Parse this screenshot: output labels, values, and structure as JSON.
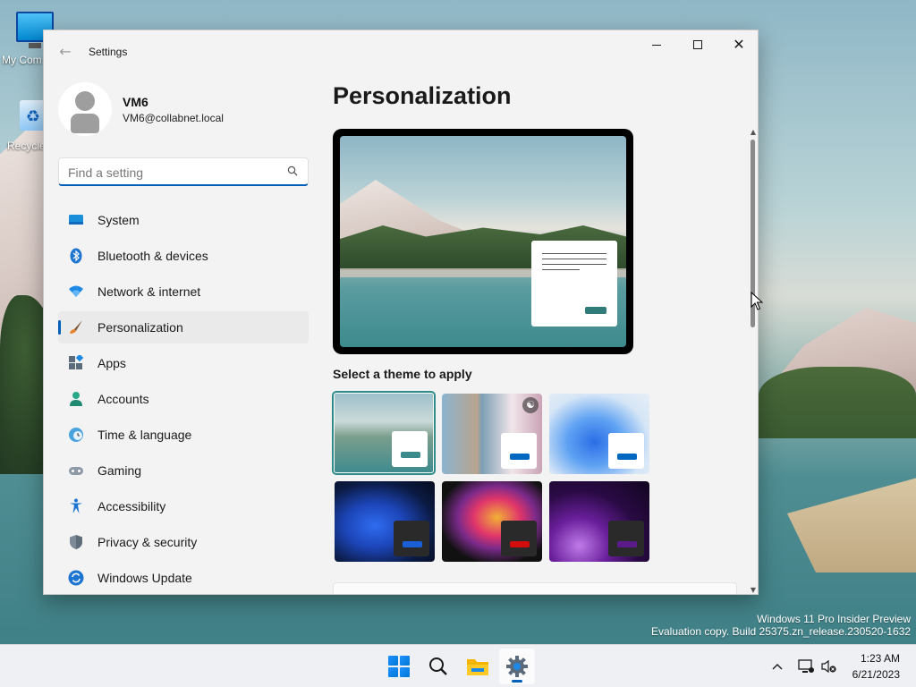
{
  "desktop": {
    "icons": [
      {
        "label": "My Com",
        "kind": "computer-icon"
      },
      {
        "label": "Recycle",
        "kind": "recycle-bin-icon"
      }
    ],
    "watermark": {
      "line1": "Windows 11 Pro Insider Preview",
      "line2": "Evaluation copy. Build 25375.zn_release.230520-1632"
    }
  },
  "window": {
    "title": "Settings",
    "controls": {
      "minimize": "minimize",
      "maximize": "maximize",
      "close": "close"
    }
  },
  "profile": {
    "name": "VM6",
    "email": "VM6@collabnet.local"
  },
  "search": {
    "placeholder": "Find a setting",
    "value": ""
  },
  "nav": {
    "items": [
      {
        "label": "System",
        "icon": "system-icon",
        "active": false
      },
      {
        "label": "Bluetooth & devices",
        "icon": "bluetooth-icon",
        "active": false
      },
      {
        "label": "Network & internet",
        "icon": "wifi-icon",
        "active": false
      },
      {
        "label": "Personalization",
        "icon": "brush-icon",
        "active": true
      },
      {
        "label": "Apps",
        "icon": "apps-icon",
        "active": false
      },
      {
        "label": "Accounts",
        "icon": "accounts-icon",
        "active": false
      },
      {
        "label": "Time & language",
        "icon": "clock-globe-icon",
        "active": false
      },
      {
        "label": "Gaming",
        "icon": "gamepad-icon",
        "active": false
      },
      {
        "label": "Accessibility",
        "icon": "accessibility-icon",
        "active": false
      },
      {
        "label": "Privacy & security",
        "icon": "shield-icon",
        "active": false
      },
      {
        "label": "Windows Update",
        "icon": "update-icon",
        "active": false
      }
    ]
  },
  "main": {
    "title": "Personalization",
    "theme_heading": "Select a theme to apply",
    "themes": [
      {
        "name": "lake",
        "selected": true,
        "accent": "#3d8a8d"
      },
      {
        "name": "flowers",
        "selected": false,
        "accent": "#0067c0"
      },
      {
        "name": "bloom-light",
        "selected": false,
        "accent": "#0067c0"
      },
      {
        "name": "bloom-dark",
        "selected": false,
        "accent": "#1a5fd6"
      },
      {
        "name": "glow",
        "selected": false,
        "accent": "#d10d0d"
      },
      {
        "name": "sunrise",
        "selected": false,
        "accent": "#5b1a8a"
      }
    ]
  },
  "taskbar": {
    "apps": [
      "start-icon",
      "search-icon",
      "file-explorer-icon",
      "settings-icon"
    ],
    "active_app": "settings-icon",
    "tray": [
      "chevron-up-icon",
      "network-icon",
      "volume-muted-icon"
    ],
    "time": "1:23 AM",
    "date": "6/21/2023"
  },
  "colors": {
    "accent": "#005fb8",
    "window_bg": "#f3f3f3",
    "taskbar_bg": "#eef0f3"
  }
}
